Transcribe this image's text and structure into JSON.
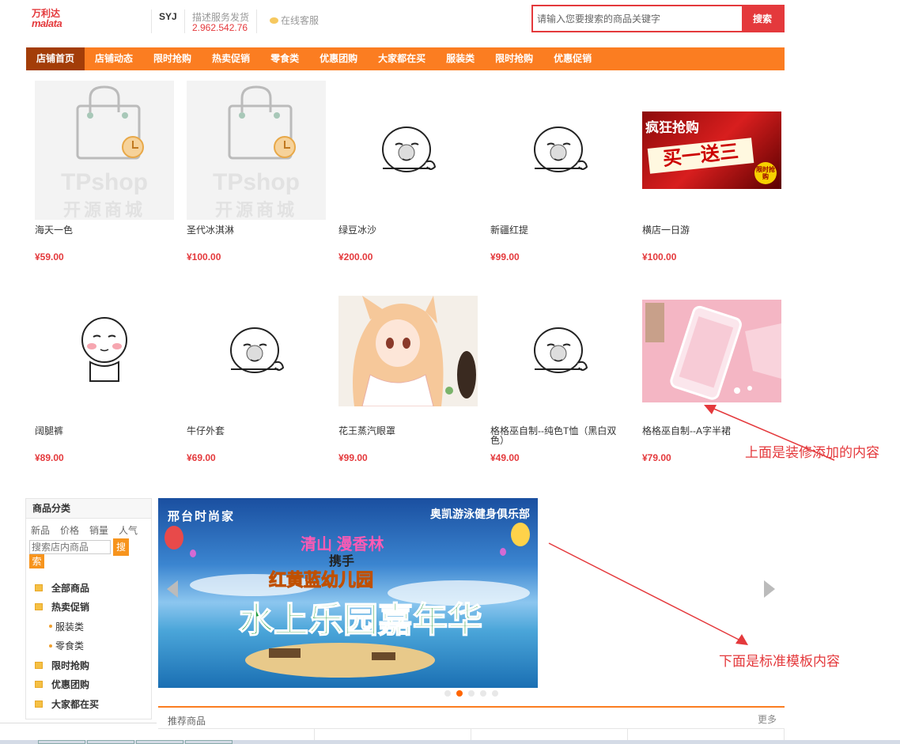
{
  "header": {
    "logo_cn": "万利达",
    "logo_en": "malata",
    "shop_name": "SYJ",
    "desc_label": "描述服务发货",
    "desc_value": "2.962.542.76",
    "service_label": "在线客服",
    "search_placeholder": "请输入您要搜索的商品关键字",
    "search_button": "搜索"
  },
  "nav": [
    "店铺首页",
    "店铺动态",
    "限时抢购",
    "热卖促销",
    "零食类",
    "优惠团购",
    "大家都在买",
    "服装类",
    "限时抢购",
    "优惠促销"
  ],
  "placeholder_brand": "TPshop",
  "placeholder_sub": "开源商城",
  "promo_text": {
    "line1": "疯狂抢购",
    "line2": "买一送三",
    "badge": "限时抢购"
  },
  "products": [
    {
      "name": "海天一色",
      "price": "¥59.00",
      "img": "tpshop-placeholder"
    },
    {
      "name": "圣代冰淇淋",
      "price": "¥100.00",
      "img": "tpshop-placeholder"
    },
    {
      "name": "绿豆冰沙",
      "price": "¥200.00",
      "img": "meme-face"
    },
    {
      "name": "新疆红提",
      "price": "¥99.00",
      "img": "meme-face"
    },
    {
      "name": "横店一日游",
      "price": "¥100.00",
      "img": "promo-buy-one-get-three"
    },
    {
      "name": "阔腿裤",
      "price": "¥89.00",
      "img": "meme-blush"
    },
    {
      "name": "牛仔外套",
      "price": "¥69.00",
      "img": "meme-face"
    },
    {
      "name": "花王蒸汽眼罩",
      "price": "¥99.00",
      "img": "anime-girl"
    },
    {
      "name": "格格巫自制--纯色T恤（黑白双色）",
      "price": "¥49.00",
      "img": "meme-face"
    },
    {
      "name": "格格巫自制--A字半裙",
      "price": "¥79.00",
      "img": "pink-phone"
    }
  ],
  "annotations": {
    "top": "上面是装修添加的内容",
    "bottom": "下面是标准模板内容"
  },
  "sidebar": {
    "title": "商品分类",
    "sort": [
      "新品",
      "价格",
      "销量",
      "人气"
    ],
    "search_placeholder": "搜索店内商品",
    "search_btn_a": "搜",
    "search_btn_b": "索",
    "categories": [
      {
        "label": "全部商品",
        "level": 1
      },
      {
        "label": "热卖促销",
        "level": 1
      },
      {
        "label": "服装类",
        "level": 2
      },
      {
        "label": "零食类",
        "level": 2
      },
      {
        "label": "限时抢购",
        "level": 1
      },
      {
        "label": "优惠团购",
        "level": 1
      },
      {
        "label": "大家都在买",
        "level": 1
      }
    ]
  },
  "banner": {
    "top_left": "邢台时尚家",
    "top_right": "奥凯游泳健身俱乐部",
    "line1": "清山 漫香林",
    "line2": "携手",
    "line3": "红黄蓝幼儿园",
    "line4": "水上乐园嘉年华",
    "slides": 5,
    "active_slide": 2
  },
  "recommend": {
    "title": "推荐商品",
    "more": "更多"
  },
  "colors": {
    "nav_bg": "#fb7d21",
    "nav_active": "#a33d08",
    "price": "#e4393c",
    "accent": "#e4393c"
  }
}
